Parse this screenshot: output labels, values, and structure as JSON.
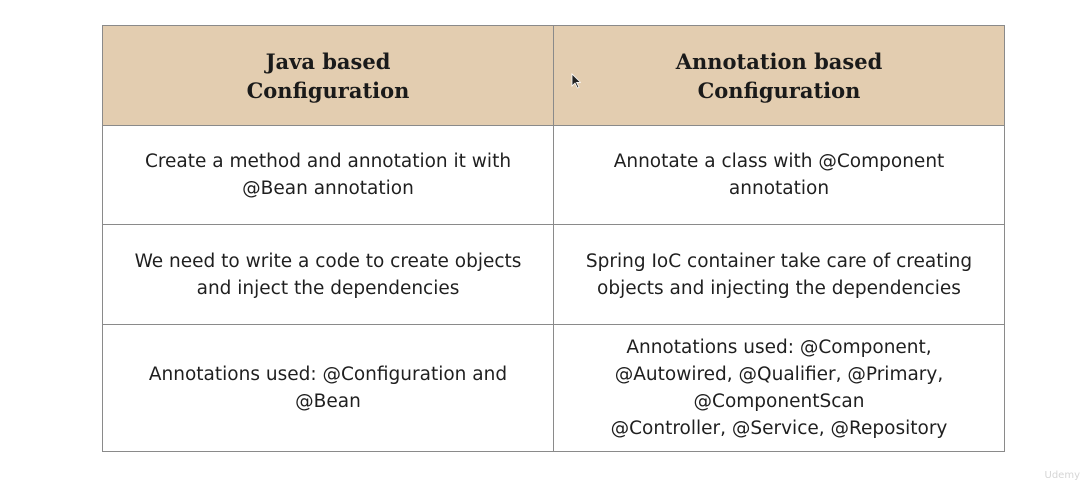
{
  "table": {
    "headers": [
      {
        "line1": "Java based",
        "line2": "Configuration"
      },
      {
        "line1": "Annotation based",
        "line2": "Configuration"
      }
    ],
    "rows": [
      {
        "java": [
          "Create a method and annotation it with",
          "@Bean annotation"
        ],
        "annotation": [
          "Annotate a class with @Component",
          "annotation"
        ]
      },
      {
        "java": [
          "We need to write a code to create objects",
          "and inject the dependencies"
        ],
        "annotation": [
          "Spring IoC container take care of creating",
          "objects and injecting the dependencies"
        ]
      },
      {
        "java": [
          "Annotations used: @Configuration and",
          "@Bean"
        ],
        "annotation": [
          "Annotations used: @Component,",
          "@Autowired, @Qualifier, @Primary,",
          "@ComponentScan",
          "@Controller, @Service, @Repository"
        ]
      }
    ]
  },
  "watermark": "Udemy",
  "cursor_icon": "mouse-pointer-icon"
}
